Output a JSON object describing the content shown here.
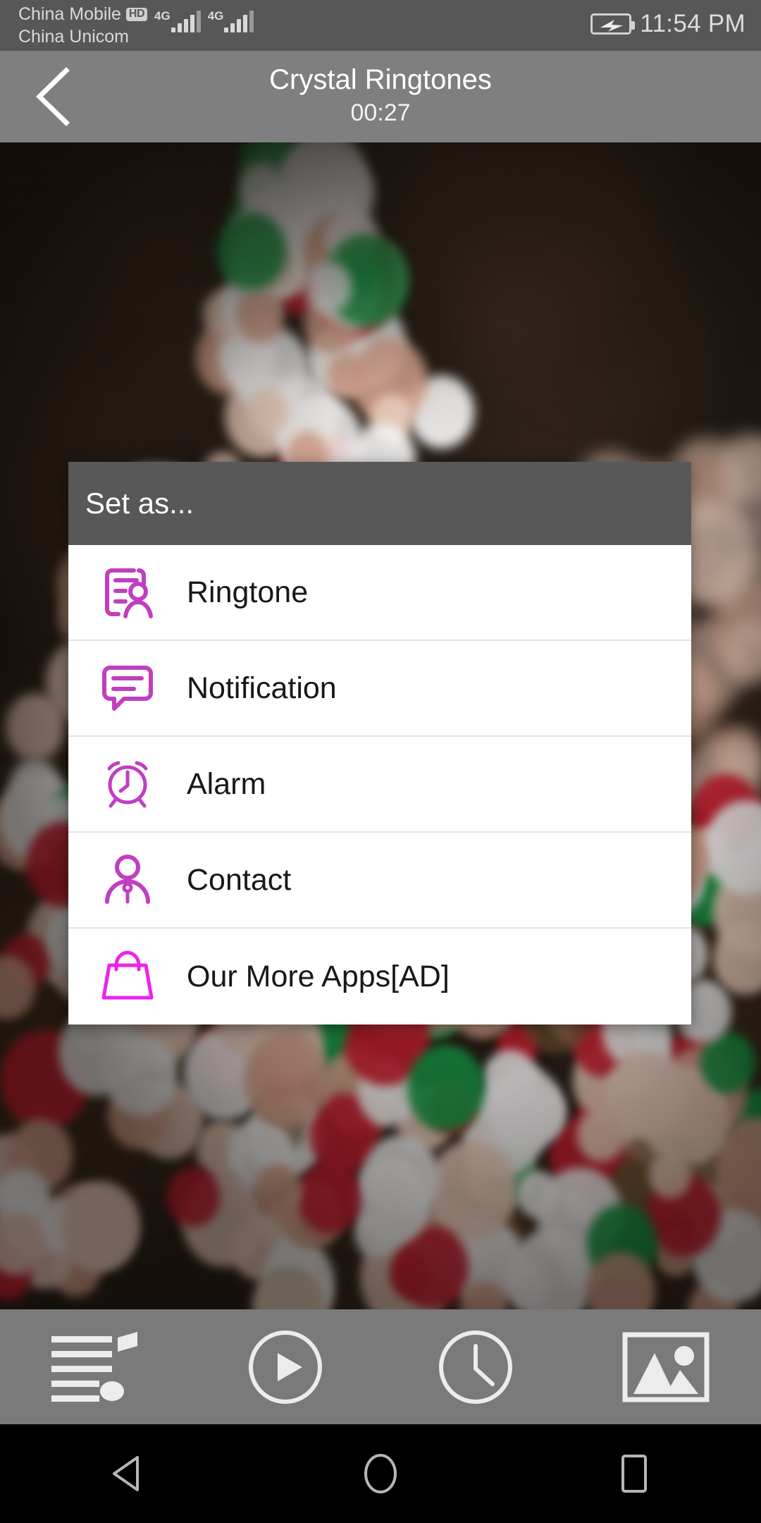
{
  "status_bar": {
    "carrier_primary": "China Mobile",
    "carrier_primary_badge": "HD",
    "carrier_secondary": "China Unicom",
    "network_1": "4G",
    "network_2": "4G",
    "time": "11:54 PM",
    "battery_icon": "battery-charging-icon",
    "bar_color": "#575757"
  },
  "title_bar": {
    "back_icon": "chevron-left-icon",
    "title": "Crystal Ringtones",
    "subtitle": "00:27",
    "bar_color": "#7f7f7f"
  },
  "dialog": {
    "header_title": "Set as...",
    "header_color": "#585858",
    "accent_color": "#c03fc0",
    "ad_accent_color": "#ee22ee",
    "items": [
      {
        "label": "Ringtone",
        "icon": "contact-card-icon"
      },
      {
        "label": "Notification",
        "icon": "speech-bubble-icon"
      },
      {
        "label": "Alarm",
        "icon": "alarm-clock-icon"
      },
      {
        "label": "Contact",
        "icon": "person-icon"
      },
      {
        "label": "Our More Apps[AD]",
        "icon": "shopping-bag-icon"
      }
    ]
  },
  "toolbar": {
    "background": "#7a7a7a",
    "items": [
      {
        "name": "playlist-music-icon",
        "label": "Playlist"
      },
      {
        "name": "play-circle-icon",
        "label": "Play"
      },
      {
        "name": "clock-icon",
        "label": "Recent"
      },
      {
        "name": "image-gallery-icon",
        "label": "Gallery"
      }
    ]
  },
  "nav_bar": {
    "back": "triangle-back-icon",
    "home": "circle-home-icon",
    "recents": "square-recents-icon"
  },
  "background": {
    "description": "blurred christmas tree bokeh lights",
    "base_color": "#241c16",
    "light_colors": [
      "#ffffff",
      "#f6d7c6",
      "#e3ac96",
      "#d21f33",
      "#18a04a",
      "#7c5a3a"
    ]
  }
}
